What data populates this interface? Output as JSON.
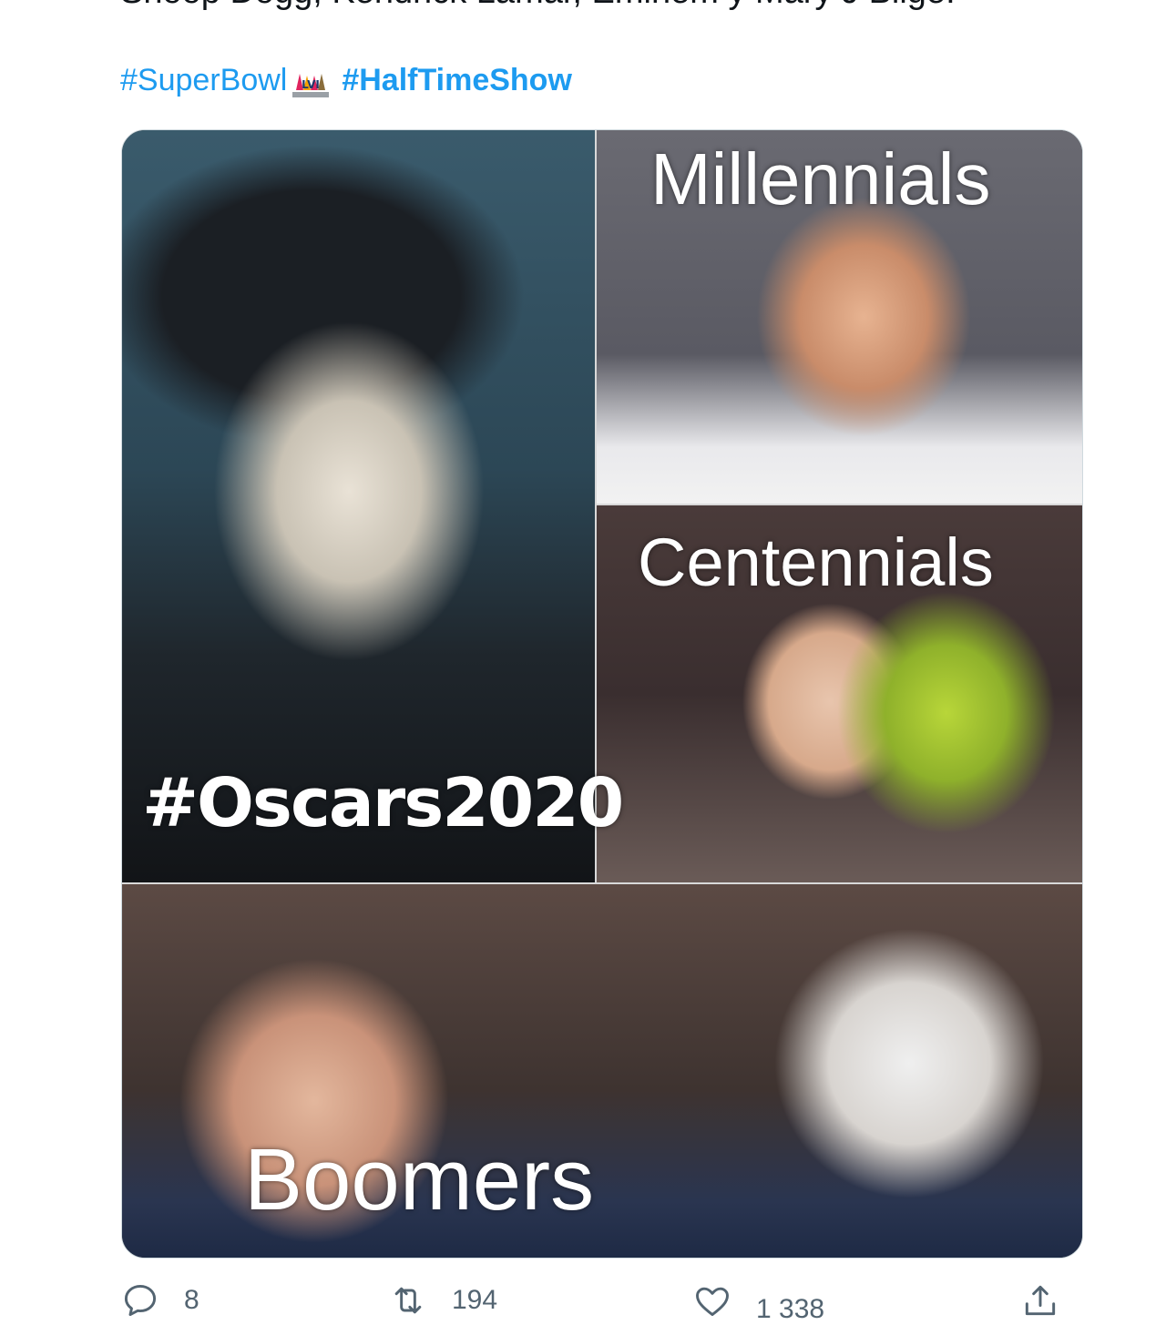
{
  "tweet": {
    "text_partial": "Snoop Dogg, Kendrick Lamar, Eminem y Mary J Blige.",
    "hashtags": [
      "#SuperBowl",
      "#HalfTimeShow"
    ],
    "superbowl_emoji": "super-bowl-lvi-logo-icon"
  },
  "media": {
    "captions": {
      "top_left": "#Oscars2020",
      "top_right": "Millennials",
      "middle_right": "Centennials",
      "bottom": "Boomers"
    }
  },
  "actions": {
    "reply_count": "8",
    "retweet_count": "194",
    "like_count": "1 338",
    "icons": [
      "reply-icon",
      "retweet-icon",
      "like-icon",
      "share-icon"
    ]
  },
  "colors": {
    "link": "#1d9bf0",
    "text": "#0f1419",
    "muted": "#536471",
    "border": "#cfd9de"
  }
}
